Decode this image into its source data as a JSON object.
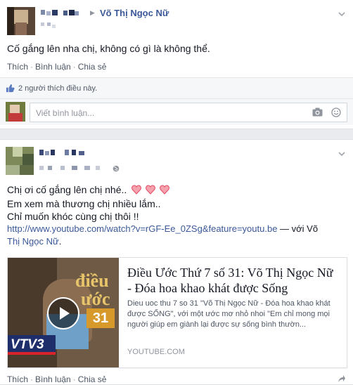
{
  "colors": {
    "link": "#3b5998",
    "text": "#141823",
    "muted": "#90949c",
    "background": "#e9ebee",
    "heart": "#f25268"
  },
  "post1": {
    "author_name": "Võ Thị Ngọc Nữ",
    "body": "Cố gắng lên nha chị, không có gì là không thể.",
    "actions": [
      "Thích",
      "Bình luận",
      "Chia sẻ"
    ],
    "likes_text": "2 người thích điều này.",
    "comment_placeholder": "Viết bình luận...",
    "icons": [
      "thumbs-up-icon",
      "camera-icon",
      "smiley-icon",
      "chevron-down-icon"
    ]
  },
  "post2": {
    "lines": [
      "Chị ơi cố gắng lên chị nhé..",
      "Em xem mà thương chị nhiều lắm..",
      "Chỉ muốn khóc cùng chị thôi !!"
    ],
    "url": "http://www.youtube.com/watch?v=rGF-Ee_0ZSg&feature=youtu.be",
    "with_prefix": " — với Võ",
    "with_name_line2": "Thị Ngọc Nữ",
    "with_suffix": ".",
    "embed": {
      "title": "Điều Ước Thứ 7 số 31: Võ Thị Ngọc Nữ - Đóa hoa khao khát được Sống",
      "description": "Dieu uoc thu 7 so 31 \"Võ Thị Ngọc Nữ - Đóa hoa khao khát được SỐNG\", với một ước mơ nhỏ nhoi \"Em chỉ mong mọi người giúp em giành lại được sự sống bình thườn...",
      "domain": "YOUTUBE.COM",
      "thumb_text_top": "điều",
      "thumb_text_mid": "ước",
      "thumb_number": "31",
      "thumb_logo": "VTV3"
    },
    "actions": [
      "Thích",
      "Bình luận",
      "Chia sẻ"
    ],
    "icons": [
      "heart-icon",
      "play-icon",
      "globe-icon",
      "chevron-down-icon",
      "share-icon"
    ]
  }
}
